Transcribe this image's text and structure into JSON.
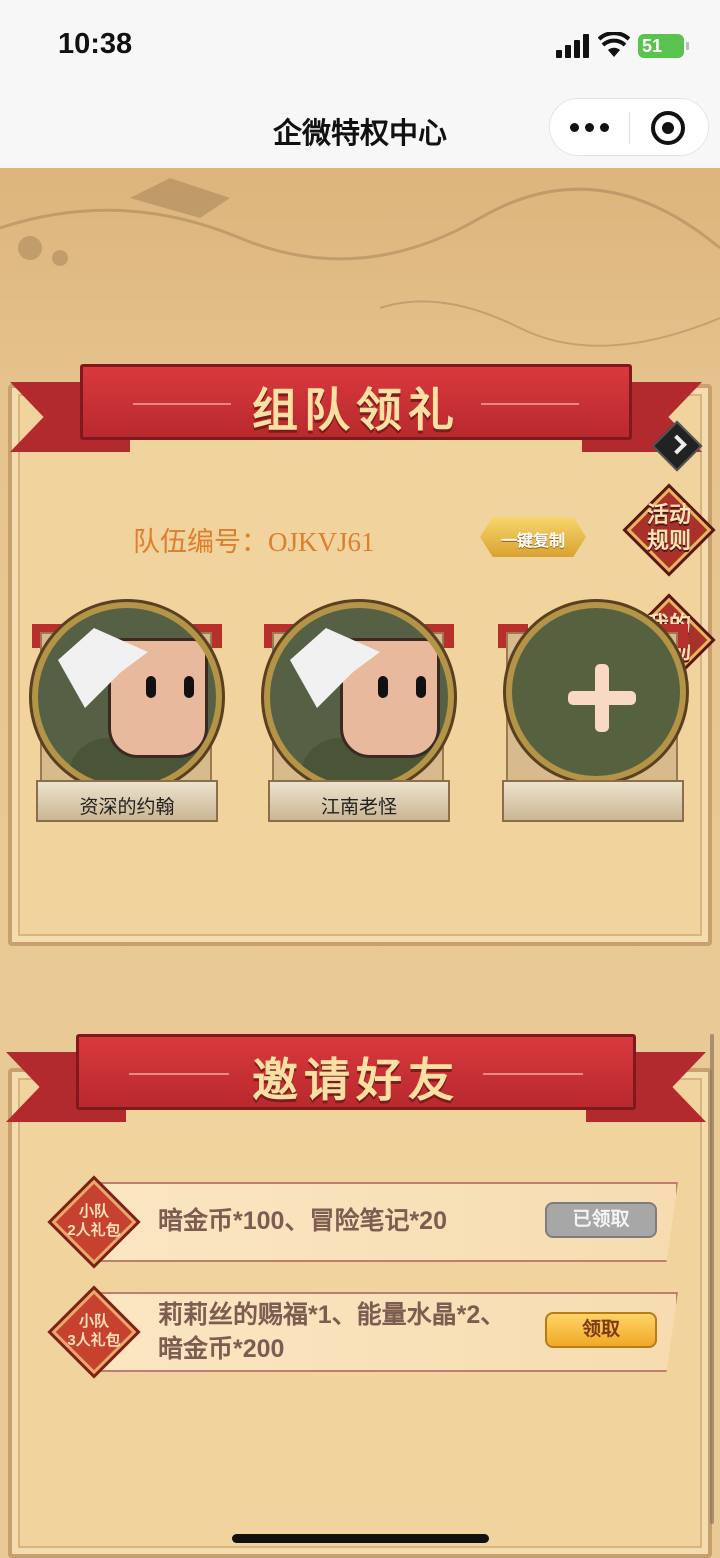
{
  "status_bar": {
    "time": "10:38",
    "battery": "51"
  },
  "nav": {
    "title": "企微特权中心"
  },
  "team_section": {
    "title": "组队领礼",
    "team_id_label": "队伍编号：OJKVJ61",
    "copy_button": "一键复制",
    "rules_button_line1": "活动",
    "rules_button_line2": "规则",
    "rewards_button_line1": "我的",
    "rewards_button_line2": "奖励",
    "members": [
      {
        "name": "资深的约翰"
      },
      {
        "name": "江南老怪"
      },
      {
        "name": ""
      }
    ]
  },
  "invite_section": {
    "title": "邀请好友",
    "rewards": [
      {
        "badge_line1": "小队",
        "badge_line2": "2人礼包",
        "text_line1": "暗金币*100、冒险笔记*20",
        "text_line2": "",
        "button": "已领取",
        "status": "claimed"
      },
      {
        "badge_line1": "小队",
        "badge_line2": "3人礼包",
        "text_line1": "莉莉丝的赐福*1、能量水晶*2、",
        "text_line2": "暗金币*200",
        "button": "领取",
        "status": "claimable"
      }
    ]
  },
  "colors": {
    "ribbon_red": "#c3302f",
    "team_id_orange": "#de7f2d",
    "claim_yellow": "#f5b93a",
    "claimed_gray": "#a7a7a7"
  }
}
